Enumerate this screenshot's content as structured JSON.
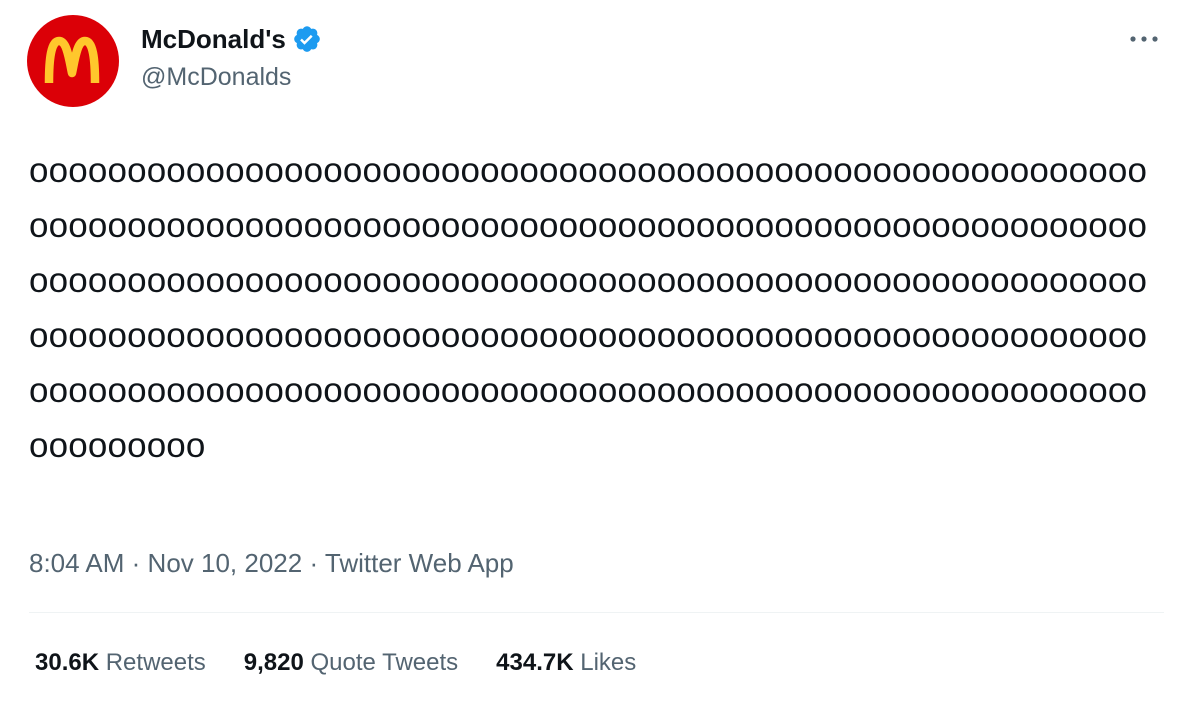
{
  "tweet": {
    "author": {
      "display_name": "McDonald's",
      "handle": "@McDonalds",
      "verified": true,
      "avatar_icon": "mcdonalds-golden-arches-logo",
      "avatar_bg": "#db0007",
      "logo_color": "#ffc72c",
      "verified_color": "#1d9bf0"
    },
    "more_icon": "more-horizontal-icon",
    "text": "oooooooooooooooooooooooooooooooooooooooooooooooooooooooooooooooooooooooooooooooooooooooooooooooooooooooooooooooooooooooooooooooooooooooooooooooooooooooooooooooooooooooooooooooooooooooooooooooooooooooooooooooooooooooooooooooooooooooooooooooooooooooooooooooooooooooooooooooooooooooooooooooooooooo",
    "time": "8:04 AM",
    "separator": "·",
    "date": "Nov 10, 2022",
    "source": "Twitter Web App",
    "stats": {
      "retweets": {
        "count": "30.6K",
        "label": "Retweets"
      },
      "quote_tweets": {
        "count": "9,820",
        "label": "Quote Tweets"
      },
      "likes": {
        "count": "434.7K",
        "label": "Likes"
      }
    }
  }
}
